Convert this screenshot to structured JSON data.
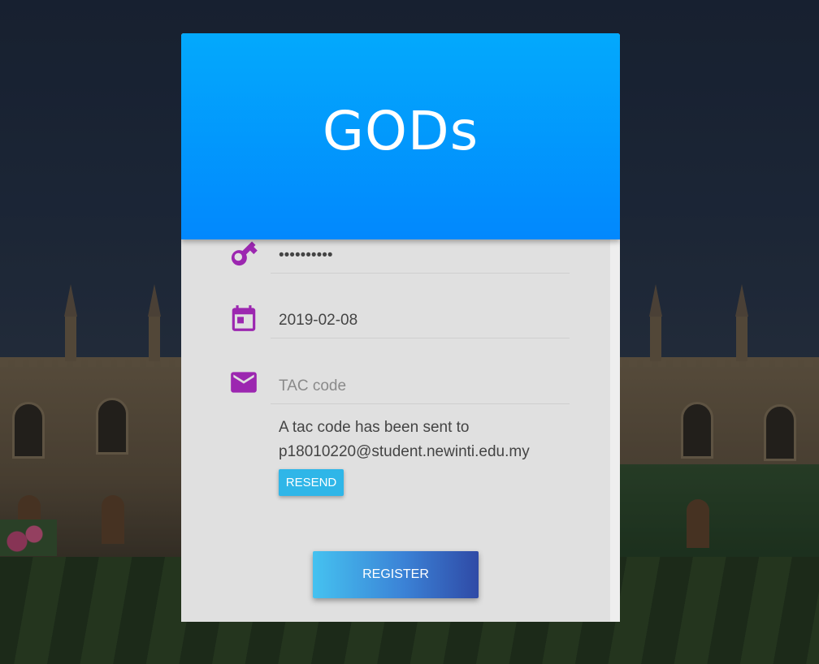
{
  "header": {
    "title": "GODs"
  },
  "form": {
    "password": {
      "value": "••••••••••",
      "icon": "key-icon"
    },
    "date": {
      "value": "2019-02-08",
      "icon": "calendar-icon"
    },
    "tac": {
      "placeholder": "TAC code",
      "value": "",
      "icon": "envelope-icon"
    },
    "tac_note_line1": "A tac code has been sent to",
    "tac_note_line2": "p18010220@student.newinti.edu.my",
    "resend_label": "RESEND",
    "register_label": "REGISTER"
  },
  "colors": {
    "header_top": "#03a9fc",
    "header_bottom": "#0288fd",
    "icon_purple": "#9c27b0",
    "resend_bg": "#2fb6e8",
    "accent_orange": "#f7a21b"
  }
}
